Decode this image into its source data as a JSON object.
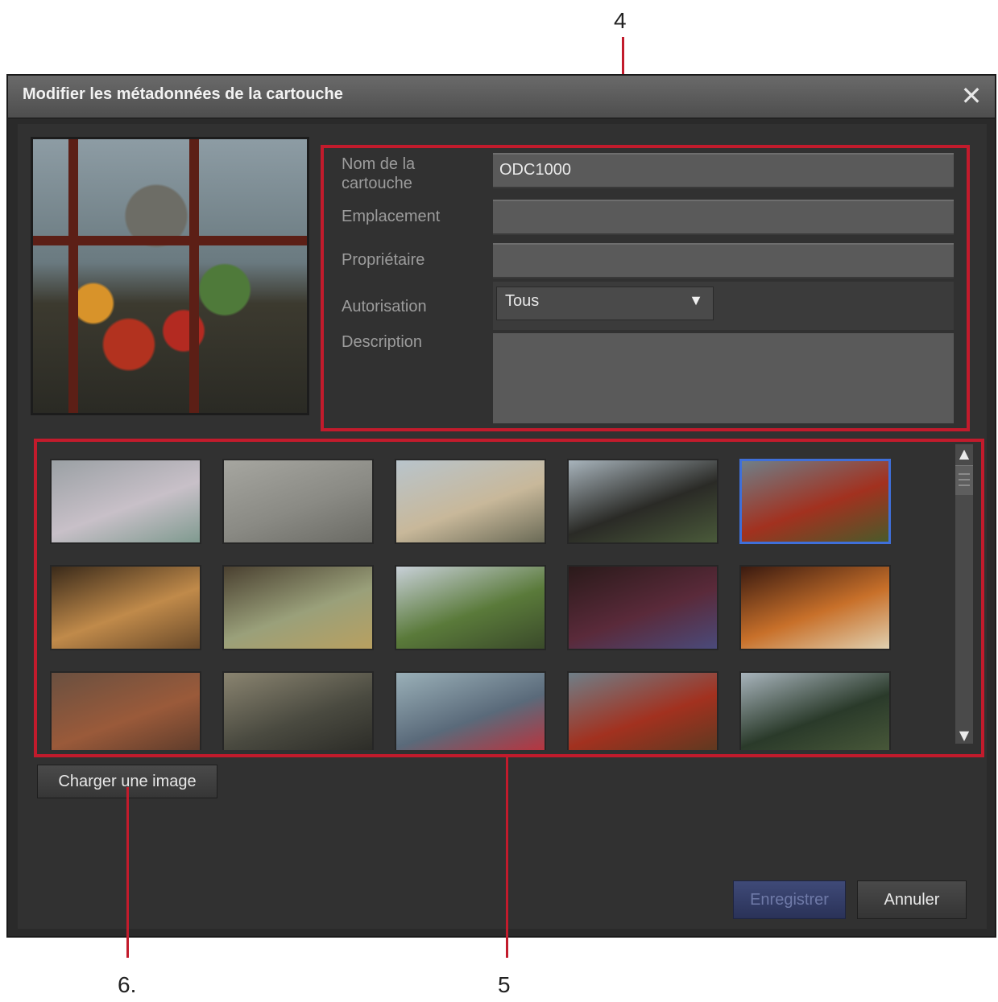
{
  "callouts": {
    "form_number": "4",
    "grid_number": "5",
    "load_number": "6."
  },
  "dialog": {
    "title": "Modifier les métadonnées de la cartouche",
    "close_icon": "close-icon"
  },
  "form": {
    "name_label": "Nom de la cartouche",
    "name_value": "ODC1000",
    "location_label": "Emplacement",
    "location_value": "",
    "owner_label": "Propriétaire",
    "owner_value": "",
    "authorization_label": "Autorisation",
    "authorization_value": "Tous",
    "description_label": "Description",
    "description_value": ""
  },
  "thumbnails": [
    {
      "name": "thumb-tree",
      "colors": [
        "#9aa0a4",
        "#c8c0c8",
        "#7f9a8f"
      ]
    },
    {
      "name": "thumb-arch",
      "colors": [
        "#a6a6a0",
        "#8a8a84",
        "#6a6a64"
      ]
    },
    {
      "name": "thumb-houses",
      "colors": [
        "#b8c4cc",
        "#c8b89a",
        "#6a6a56"
      ]
    },
    {
      "name": "thumb-train-1",
      "colors": [
        "#a8b4bc",
        "#2a2a26",
        "#4a5a3a"
      ]
    },
    {
      "name": "thumb-window-flowers",
      "colors": [
        "#6f7f88",
        "#a2311f",
        "#4a5a2a"
      ]
    },
    {
      "name": "thumb-bread-1",
      "colors": [
        "#3a2a1a",
        "#c08a4a",
        "#6a4a2a"
      ]
    },
    {
      "name": "thumb-cabbage",
      "colors": [
        "#4a4030",
        "#9aa07a",
        "#b8a060"
      ]
    },
    {
      "name": "thumb-landscape",
      "colors": [
        "#c8d0d8",
        "#5a7a3a",
        "#3a4a2a"
      ]
    },
    {
      "name": "thumb-stained-glass",
      "colors": [
        "#2a1a1a",
        "#5a2a3a",
        "#4a4a7a"
      ]
    },
    {
      "name": "thumb-dinner",
      "colors": [
        "#3a1a10",
        "#c8702a",
        "#e0d0b0"
      ]
    },
    {
      "name": "thumb-rails",
      "colors": [
        "#6a5040",
        "#9a5a3a",
        "#5a3a2a"
      ]
    },
    {
      "name": "thumb-office",
      "colors": [
        "#8a8470",
        "#4a4a40",
        "#2a2a26"
      ]
    },
    {
      "name": "thumb-toy",
      "colors": [
        "#9ab0b8",
        "#5a6a7a",
        "#c0303a"
      ]
    },
    {
      "name": "thumb-window-2",
      "colors": [
        "#6f7f88",
        "#a2311f",
        "#5a3a20"
      ]
    },
    {
      "name": "thumb-train-2",
      "colors": [
        "#a8b4bc",
        "#2a3a2a",
        "#4a5a3a"
      ]
    }
  ],
  "scrollbar": {
    "up_icon": "▲",
    "down_icon": "▼"
  },
  "buttons": {
    "load_image": "Charger une image",
    "save": "Enregistrer",
    "cancel": "Annuler"
  },
  "colors": {
    "callout_red": "#c21b2c",
    "selection_blue": "#3f6fd9"
  }
}
